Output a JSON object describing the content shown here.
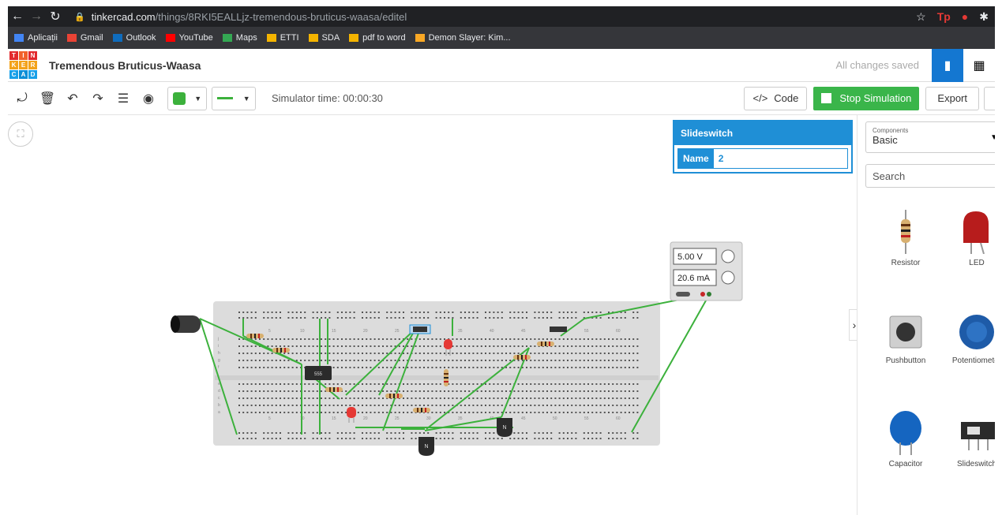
{
  "browser": {
    "url_host": "tinkercad.com",
    "url_path": "/things/8RKI5EALLjz-tremendous-bruticus-waasa/editel",
    "bookmarks": [
      {
        "label": "Aplicații",
        "color": "#4285f4"
      },
      {
        "label": "Gmail",
        "color": "#ea4335"
      },
      {
        "label": "Outlook",
        "color": "#0f6cbd"
      },
      {
        "label": "YouTube",
        "color": "#ff0000"
      },
      {
        "label": "Maps",
        "color": "#34a853"
      },
      {
        "label": "ETTI",
        "color": "#f4b400"
      },
      {
        "label": "SDA",
        "color": "#f4b400"
      },
      {
        "label": "pdf to word",
        "color": "#f4b400"
      },
      {
        "label": "Demon Slayer: Kim...",
        "color": "#f9a825"
      }
    ]
  },
  "header": {
    "logo": [
      "T",
      "I",
      "N",
      "K",
      "E",
      "R",
      "C",
      "A",
      "D"
    ],
    "logo_colors": [
      "#e2292d",
      "#f1602a",
      "#e2292d",
      "#f3a21a",
      "#f3a21a",
      "#f3a21a",
      "#19a0e8",
      "#0c8ed6",
      "#19a0e8"
    ],
    "title": "Tremendous Bruticus-Waasa",
    "saved_status": "All changes saved"
  },
  "toolbar": {
    "sim_time": "Simulator time: 00:00:30",
    "code_label": "Code",
    "stop_label": "Stop Simulation",
    "export_label": "Export"
  },
  "inspector": {
    "title": "Slideswitch",
    "name_label": "Name",
    "name_value": "2"
  },
  "power_supply": {
    "voltage": "5.00 V",
    "current": "20.6 mA"
  },
  "chip_label": "555",
  "transistor_label": "N",
  "breadboard_columns": [
    "5",
    "10",
    "15",
    "20",
    "25",
    "30",
    "35",
    "40",
    "45",
    "50",
    "55",
    "60"
  ],
  "breadboard_rows": [
    "a",
    "b",
    "c",
    "d",
    "e",
    "f",
    "g",
    "h",
    "i",
    "j"
  ],
  "panel": {
    "category_caption": "Components",
    "category_value": "Basic",
    "search_placeholder": "Search",
    "components": [
      "Resistor",
      "LED",
      "Pushbutton",
      "Potentiometer",
      "Capacitor",
      "Slideswitch"
    ]
  },
  "colors": {
    "wire": "#3cb13c",
    "accent": "#1f8fd6",
    "stop_green": "#3ab54a"
  }
}
